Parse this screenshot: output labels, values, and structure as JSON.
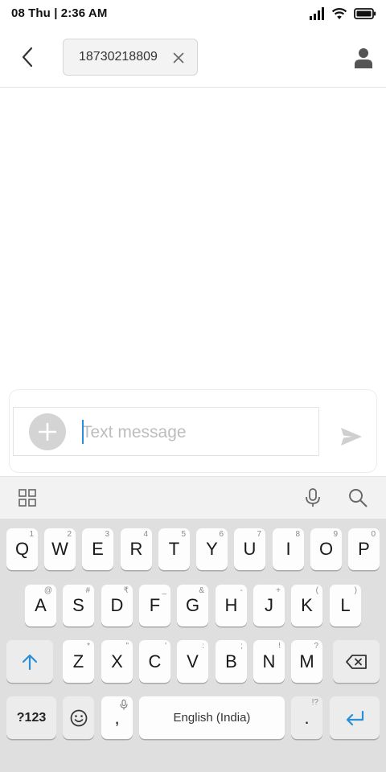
{
  "status_bar": {
    "time": "08 Thu | 2:36 AM",
    "icons": [
      "signal-icon",
      "wifi-icon",
      "battery-icon"
    ]
  },
  "header": {
    "back_icon": "chevron-left-icon",
    "recipient": "18730218809",
    "chip_close_icon": "close-icon",
    "contact_icon": "person-icon"
  },
  "composer": {
    "placeholder": "Text message",
    "value": "",
    "add_icon": "plus-icon",
    "send_icon": "send-icon"
  },
  "keyboard_toolbar": {
    "icons": [
      "apps-grid-icon",
      "microphone-icon",
      "search-icon"
    ]
  },
  "keyboard": {
    "row1": [
      {
        "label": "Q",
        "hint": "1"
      },
      {
        "label": "W",
        "hint": "2"
      },
      {
        "label": "E",
        "hint": "3"
      },
      {
        "label": "R",
        "hint": "4"
      },
      {
        "label": "T",
        "hint": "5"
      },
      {
        "label": "Y",
        "hint": "6"
      },
      {
        "label": "U",
        "hint": "7"
      },
      {
        "label": "I",
        "hint": "8"
      },
      {
        "label": "O",
        "hint": "9"
      },
      {
        "label": "P",
        "hint": "0"
      }
    ],
    "row2": [
      {
        "label": "A",
        "hint": "@"
      },
      {
        "label": "S",
        "hint": "#"
      },
      {
        "label": "D",
        "hint": "₹"
      },
      {
        "label": "F",
        "hint": "_"
      },
      {
        "label": "G",
        "hint": "&"
      },
      {
        "label": "H",
        "hint": "-"
      },
      {
        "label": "J",
        "hint": "+"
      },
      {
        "label": "K",
        "hint": "("
      },
      {
        "label": "L",
        "hint": ")"
      }
    ],
    "row3": [
      {
        "label": "Z",
        "hint": "*"
      },
      {
        "label": "X",
        "hint": "\""
      },
      {
        "label": "C",
        "hint": "'"
      },
      {
        "label": "V",
        "hint": ":"
      },
      {
        "label": "B",
        "hint": ";"
      },
      {
        "label": "N",
        "hint": "!"
      },
      {
        "label": "M",
        "hint": "?"
      }
    ],
    "shift_icon": "shift-arrow-icon",
    "backspace_icon": "backspace-icon",
    "symbols_label": "?123",
    "emoji_icon": "emoji-icon",
    "comma_label": ",",
    "comma_hint_icon": "microphone-icon",
    "space_label": "English (India)",
    "period_label": ".",
    "period_hint": "!?",
    "enter_icon": "enter-arrow-icon"
  },
  "colors": {
    "accent": "#2a8fd6",
    "keyboard_bg": "#dfdfdf",
    "key_bg": "#fdfdfd",
    "placeholder": "#bdbdbd"
  }
}
